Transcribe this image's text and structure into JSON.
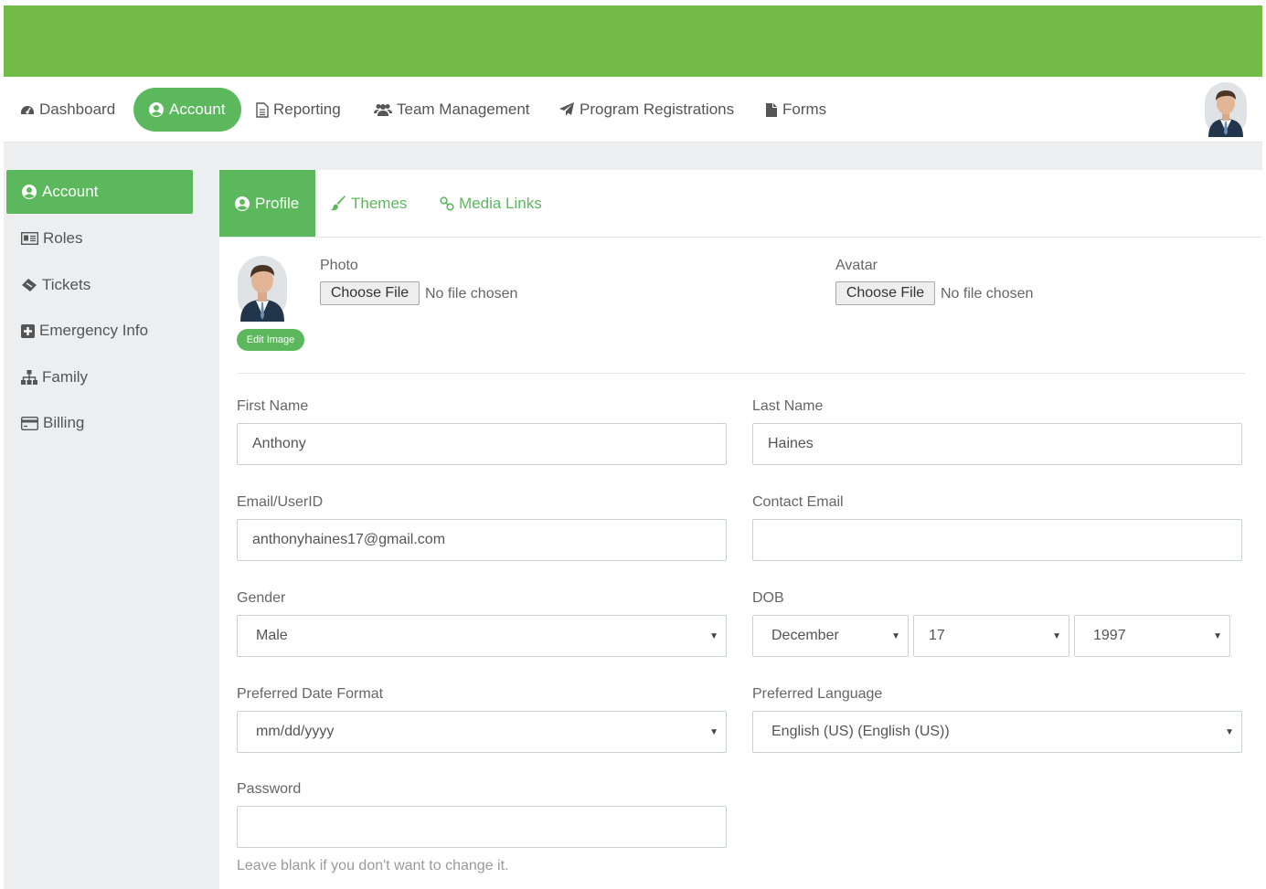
{
  "colors": {
    "banner": "#72bb46",
    "accent": "#5cb85c"
  },
  "topnav": {
    "items": [
      {
        "label": "Dashboard",
        "icon": "tachometer-icon"
      },
      {
        "label": "Account",
        "icon": "user-circle-icon",
        "active": true
      },
      {
        "label": "Reporting",
        "icon": "file-text-icon"
      },
      {
        "label": "Team Management",
        "icon": "users-icon"
      },
      {
        "label": "Program Registrations",
        "icon": "paper-plane-icon"
      },
      {
        "label": "Forms",
        "icon": "file-icon"
      }
    ],
    "user_avatar": "user-avatar-photo"
  },
  "sidebar": {
    "items": [
      {
        "label": "Account",
        "icon": "user-circle-icon",
        "active": true
      },
      {
        "label": "Roles",
        "icon": "id-card-icon"
      },
      {
        "label": "Tickets",
        "icon": "ticket-icon"
      },
      {
        "label": "Emergency Info",
        "icon": "plus-square-icon"
      },
      {
        "label": "Family",
        "icon": "sitemap-icon"
      },
      {
        "label": "Billing",
        "icon": "credit-card-icon"
      }
    ]
  },
  "tabs": [
    {
      "label": "Profile",
      "icon": "user-circle-icon",
      "active": true
    },
    {
      "label": "Themes",
      "icon": "paint-brush-icon"
    },
    {
      "label": "Media Links",
      "icon": "link-icon"
    }
  ],
  "profile": {
    "edit_image_label": "Edit Image",
    "photo": {
      "label": "Photo",
      "button": "Choose File",
      "status": "No file chosen"
    },
    "avatar": {
      "label": "Avatar",
      "button": "Choose File",
      "status": "No file chosen"
    },
    "first_name": {
      "label": "First Name",
      "value": "Anthony"
    },
    "last_name": {
      "label": "Last Name",
      "value": "Haines"
    },
    "email": {
      "label": "Email/UserID",
      "value": "anthonyhaines17@gmail.com"
    },
    "contact_email": {
      "label": "Contact Email",
      "value": ""
    },
    "gender": {
      "label": "Gender",
      "value": "Male"
    },
    "dob": {
      "label": "DOB",
      "month": "December",
      "day": "17",
      "year": "1997"
    },
    "date_format": {
      "label": "Preferred Date Format",
      "value": "mm/dd/yyyy"
    },
    "language": {
      "label": "Preferred Language",
      "value": "English (US) (English (US))"
    },
    "password": {
      "label": "Password",
      "value": "",
      "help": "Leave blank if you don't want to change it."
    }
  }
}
